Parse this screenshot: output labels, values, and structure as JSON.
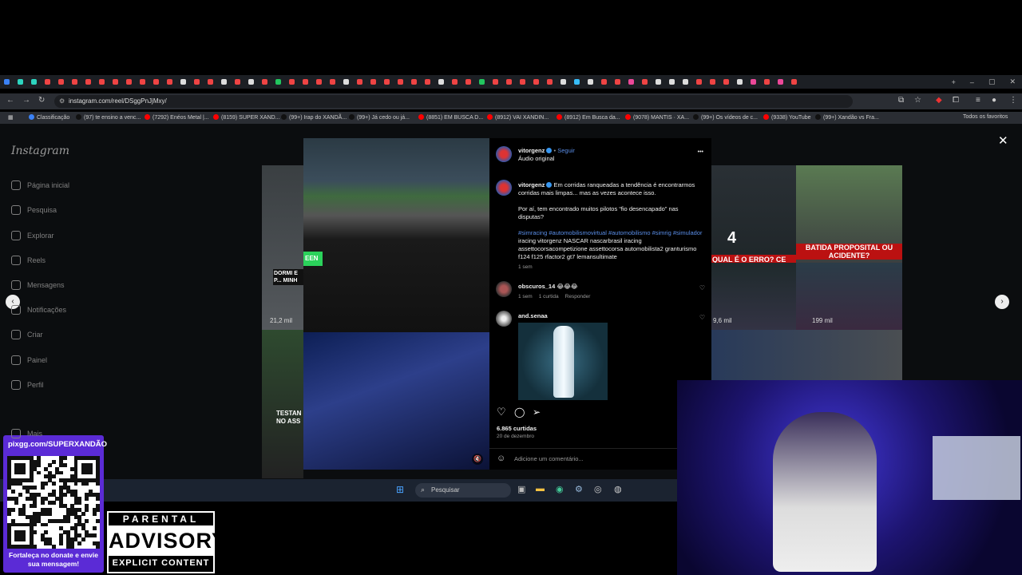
{
  "browser": {
    "url": "instagram.com/reel/DSggPnJjMxy/",
    "window_controls": [
      "–",
      "▢",
      "✕"
    ],
    "new_tab": "+"
  },
  "bookmarks": [
    {
      "label": "Classificação",
      "color": "#3b82f6"
    },
    {
      "label": "(97) te ensino a venc...",
      "color": "#111"
    },
    {
      "label": "(7292) Enéos Metal |...",
      "color": "#ff0000"
    },
    {
      "label": "(8159) SUPER XAND...",
      "color": "#ff0000"
    },
    {
      "label": "(99+) Irap do XANDÃ...",
      "color": "#111"
    },
    {
      "label": "(99+) Já cedo ou já...",
      "color": "#111"
    },
    {
      "label": "(8851) EM BUSCA D...",
      "color": "#ff0000"
    },
    {
      "label": "(8912) VAI XANDIN...",
      "color": "#ff0000"
    },
    {
      "label": "(8912) Em Busca da...",
      "color": "#ff0000"
    },
    {
      "label": "(9078) MANTIS · XA...",
      "color": "#ff0000"
    },
    {
      "label": "(99+) Os vídeos de c...",
      "color": "#111"
    },
    {
      "label": "(9338) YouTube",
      "color": "#ff0000"
    },
    {
      "label": "(99+) Xandão vs Fra...",
      "color": "#111"
    }
  ],
  "bookmarks_all": "Todos os favoritos",
  "instagram": {
    "logo": "Instagram",
    "sidebar": [
      {
        "label": "Página inicial",
        "icon": "home-icon"
      },
      {
        "label": "Pesquisa",
        "icon": "search-icon"
      },
      {
        "label": "Explorar",
        "icon": "compass-icon"
      },
      {
        "label": "Reels",
        "icon": "reels-icon"
      },
      {
        "label": "Mensagens",
        "icon": "messages-icon"
      },
      {
        "label": "Notificações",
        "icon": "heart-icon"
      },
      {
        "label": "Criar",
        "icon": "plus-icon"
      },
      {
        "label": "Painel",
        "icon": "chart-icon"
      },
      {
        "label": "Perfil",
        "icon": "profile-icon"
      },
      {
        "label": "Mais",
        "icon": "menu-icon"
      }
    ],
    "background_thumbs": {
      "left_top_caption": "DORMI E P... MINH",
      "left_top_views": "21,2 mil",
      "left_bottom_caption": "TESTAN NO ASS",
      "right_top_num": "4",
      "right_top_caption": "QUAL É O ERRO? CE CONSEGUE VER?",
      "right_top2_caption": "BATIDA PROPOSITAL OU ACIDENTE?",
      "right_views_1": "9,6 mil",
      "right_views_2": "199 mil"
    },
    "video": {
      "tag": "EEN",
      "mute": "🔇"
    },
    "post": {
      "username": "vitorgenz",
      "follow": "Seguir",
      "audio": "Áudio original",
      "more": "•••",
      "caption_user": "vitorgenz",
      "caption_line1": "Em corridas ranqueadas a tendência é encontrarmos corridas mais limpas... mas as vezes acontece isso.",
      "caption_line2": "Por aí, tem encontrado muitos pilotos “fio desencapado” nas disputas?",
      "hashtags": "#simracing #automobilismovirtual #automobilismo #simrig #simulador",
      "tags_plain": "iracing vitorgenz NASCAR nascarbrasil iracing assettocorsacompetizione assettocorsa automobilista2 granturismo f124 f125 rfactor2 gt7 lemansultimate",
      "caption_time": "1 sem",
      "comments": [
        {
          "user": "obscuros_14",
          "text": "😂😂😂",
          "time": "1 sem",
          "likes": "1 curtida",
          "reply": "Responder"
        },
        {
          "user": "and.senaa",
          "text": ""
        }
      ],
      "likes": "6.865 curtidas",
      "date": "20 de dezembro",
      "comment_placeholder": "Adicione um comentário..."
    },
    "close": "✕",
    "prev": "‹",
    "next": "›"
  },
  "taskbar": {
    "search": "Pesquisar"
  },
  "overlay": {
    "pix_url": "pixgg.com/SUPERXANDÃO",
    "pix_message": "Fortaleça no donate e envie sua mensagem!",
    "advisory_1": "PARENTAL",
    "advisory_2": "ADVISORY",
    "advisory_3": "EXPLICIT CONTENT"
  }
}
